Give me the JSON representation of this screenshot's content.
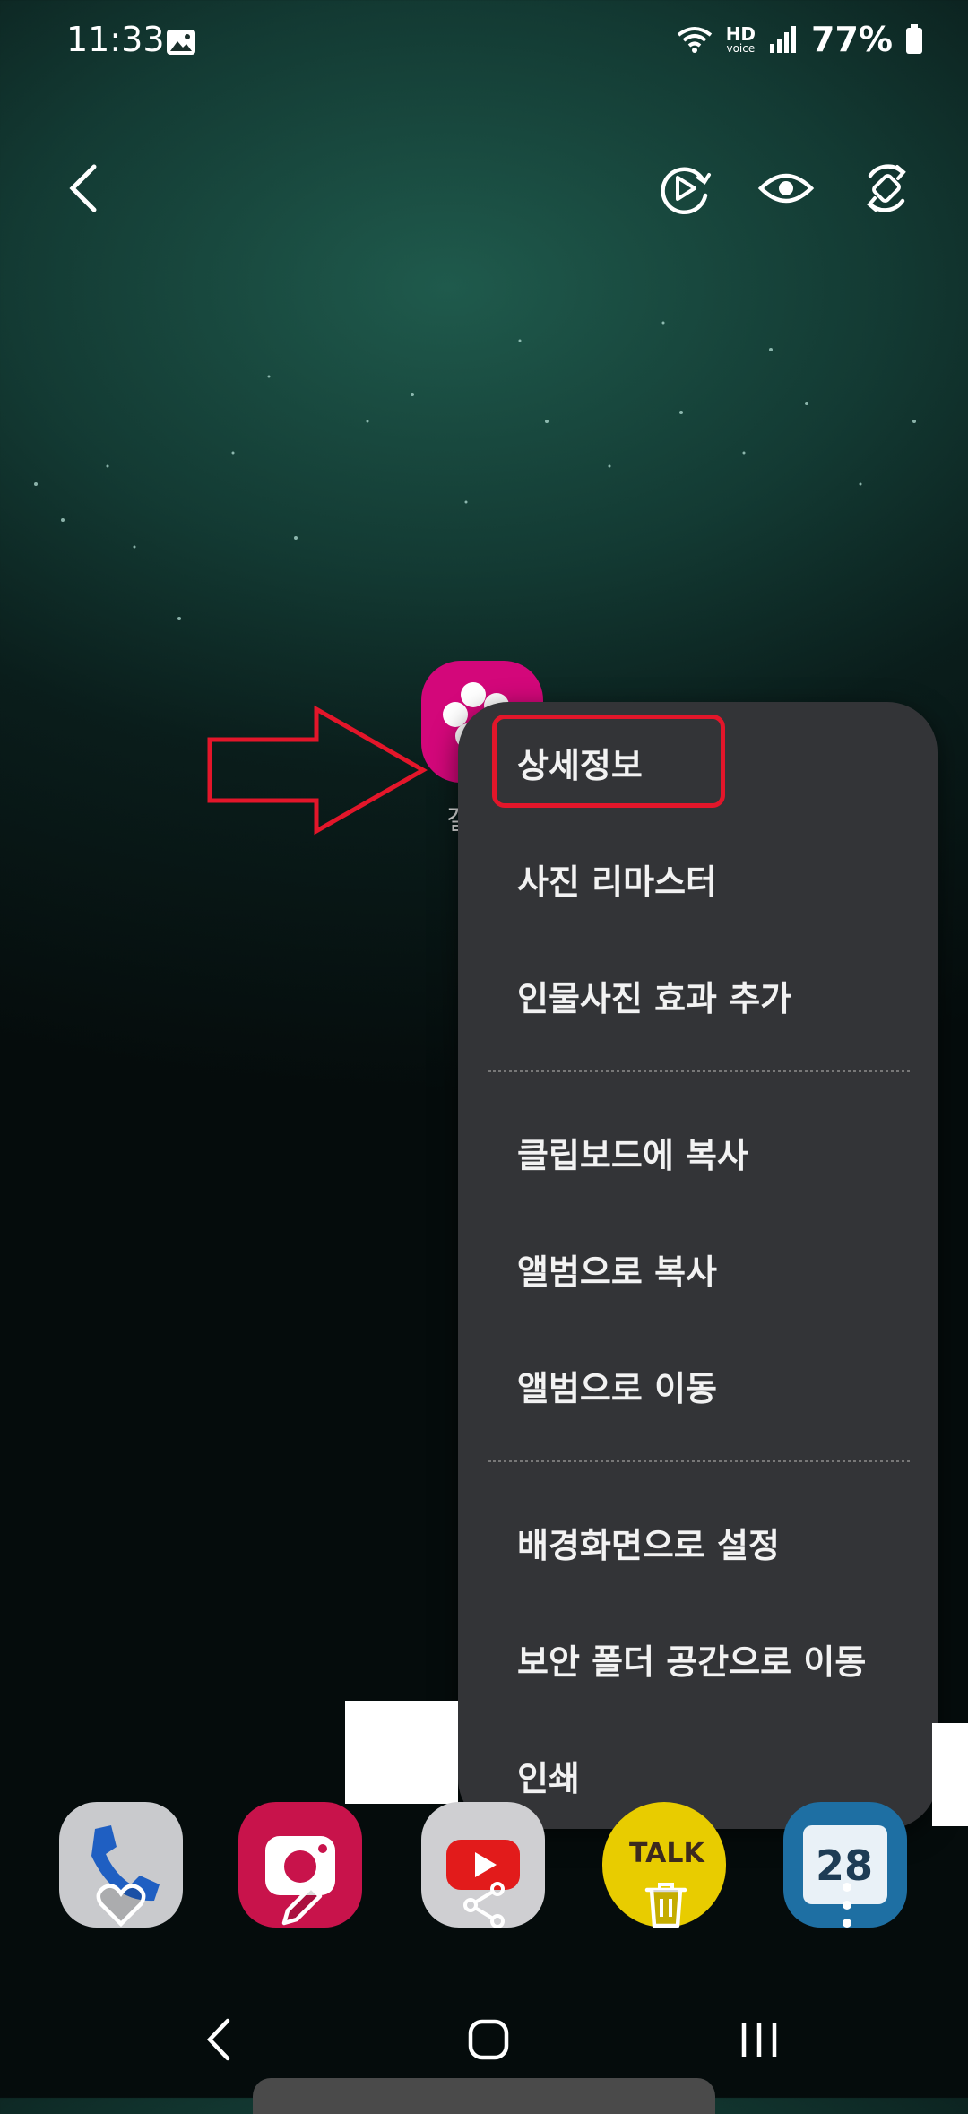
{
  "status_bar": {
    "time": "11:33",
    "hd_label": "HD",
    "voice_label": "voice",
    "battery": "77%"
  },
  "app": {
    "label_partial": "갤"
  },
  "menu": {
    "items": [
      "상세정보",
      "사진 리마스터",
      "인물사진 효과 추가",
      "클립보드에 복사",
      "앨범으로 복사",
      "앨범으로 이동",
      "배경화면으로 설정",
      "보안 폴더 공간으로 이동",
      "인쇄"
    ]
  },
  "dock": {
    "kakao_label": "TALK",
    "calendar_day": "28"
  },
  "colors": {
    "menu_bg": "#333437",
    "highlight": "#e3162a",
    "gallery_app": "#d3077a"
  }
}
